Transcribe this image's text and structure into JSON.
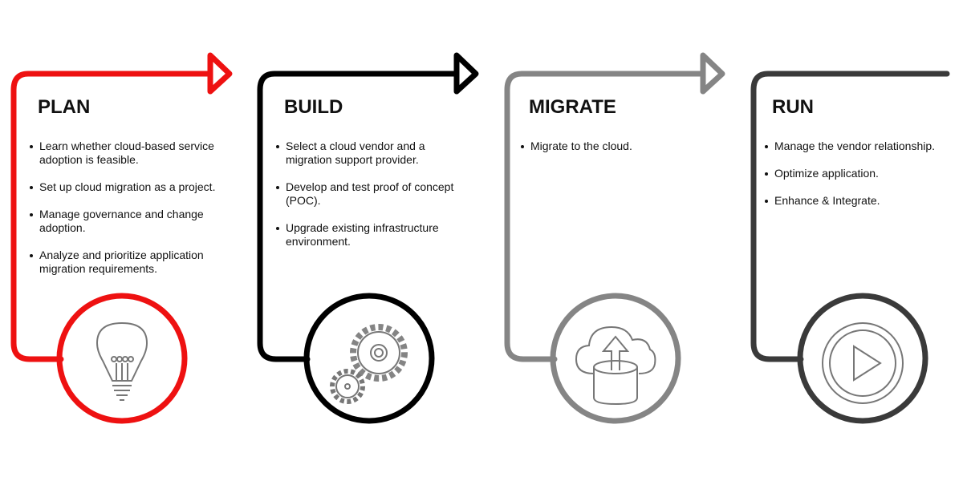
{
  "phases": [
    {
      "title": "PLAN",
      "color": "#ee1111",
      "icon": "lightbulb-icon",
      "items": [
        "Learn whether cloud-based service adoption is feasible.",
        "Set up cloud migration as a project.",
        "Manage governance and change adoption.",
        "Analyze and prioritize application migration requirements."
      ]
    },
    {
      "title": "BUILD",
      "color": "#000000",
      "icon": "gears-icon",
      "items": [
        "Select a cloud vendor and a migration support provider.",
        "Develop and test proof of concept (POC).",
        "Upgrade existing infrastructure environment."
      ]
    },
    {
      "title": "MIGRATE",
      "color": "#858585",
      "icon": "cloud-upload-icon",
      "items": [
        "Migrate to the cloud."
      ]
    },
    {
      "title": "RUN",
      "color": "#3a3a3a",
      "icon": "play-icon",
      "items": [
        "Manage the vendor relationship.",
        "Optimize application.",
        "Enhance & Integrate."
      ]
    }
  ],
  "icon_color": "#777777"
}
